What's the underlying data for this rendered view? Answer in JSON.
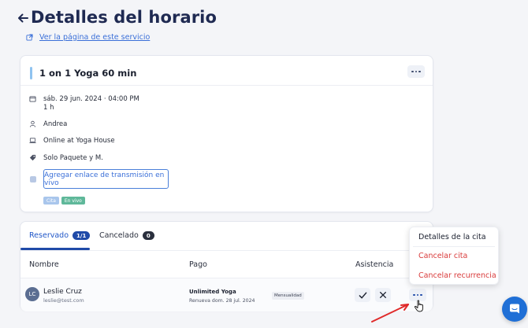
{
  "header": {
    "title": "Detalles del horario",
    "service_link": "Ver la página de este servicio"
  },
  "appointment": {
    "title": "1 on 1 Yoga 60 min",
    "date": "sáb. 29 jun. 2024 · 04:00 PM",
    "duration": "1 h",
    "instructor": "Andrea",
    "location": "Online at Yoga House",
    "package": "Solo Paquete y M.",
    "stream_button": "Agregar enlace de transmisión en vivo",
    "tags": [
      "Cita",
      "En vivo"
    ]
  },
  "tabs": [
    {
      "label": "Reservado",
      "count": "1/1"
    },
    {
      "label": "Cancelado",
      "count": "0"
    }
  ],
  "table": {
    "headers": [
      "Nombre",
      "Pago",
      "Asistencia"
    ],
    "row": {
      "avatar": "LC",
      "name": "Leslie Cruz",
      "email": "leslie@test.com",
      "plan": "Unlimited Yoga",
      "renewal": "Renueva dom. 28 jul. 2024",
      "plan_type": "Mensualidad"
    }
  },
  "dropdown": {
    "items": [
      "Detalles de la cita",
      "Cancelar cita",
      "Cancelar recurrencia"
    ]
  },
  "colors": {
    "primary": "#1f4aa8",
    "link": "#3a6fd8",
    "danger": "#d93b3b",
    "chat": "#1f6fd6"
  }
}
